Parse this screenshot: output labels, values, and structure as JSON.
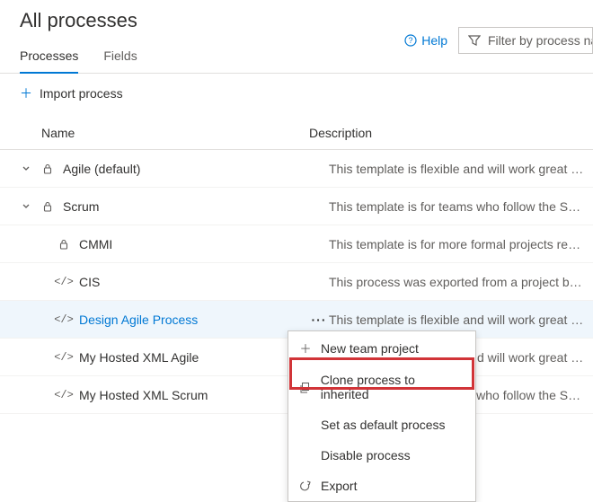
{
  "header": {
    "title": "All processes",
    "help_label": "Help",
    "filter_placeholder": "Filter by process na"
  },
  "tabs": {
    "processes": "Processes",
    "fields": "Fields"
  },
  "actions": {
    "import_process": "Import process"
  },
  "columns": {
    "name": "Name",
    "description": "Description"
  },
  "rows": [
    {
      "name": "Agile (default)",
      "desc": "This template is flexible and will work great for ...",
      "icon": "lock",
      "expandable": true
    },
    {
      "name": "Scrum",
      "desc": "This template is for teams who follow the Scru...",
      "icon": "lock",
      "expandable": true
    },
    {
      "name": "CMMI",
      "desc": "This template is for more formal projects requi...",
      "icon": "lock",
      "expandable": false,
      "indent": 1
    },
    {
      "name": "CIS",
      "desc": "This process was exported from a project but n...",
      "icon": "code",
      "expandable": false,
      "indent": 1
    },
    {
      "name": "Design Agile Process",
      "desc": "This template is flexible and will work great for ...",
      "icon": "code",
      "expandable": false,
      "indent": 1,
      "selected": true,
      "link": true
    },
    {
      "name": "My Hosted XML Agile",
      "desc": "This template is flexible and will work great for ...",
      "icon": "code",
      "expandable": false,
      "indent": 1
    },
    {
      "name": "My Hosted XML Scrum",
      "desc": "This template is for teams who follow the Scru...",
      "icon": "code",
      "expandable": false,
      "indent": 1
    }
  ],
  "context_menu": [
    {
      "label": "New team project",
      "icon": "plus"
    },
    {
      "label": "Clone process to inherited",
      "icon": "clone"
    },
    {
      "label": "Set as default process",
      "icon": ""
    },
    {
      "label": "Disable process",
      "icon": ""
    },
    {
      "label": "Export",
      "icon": "export"
    }
  ]
}
